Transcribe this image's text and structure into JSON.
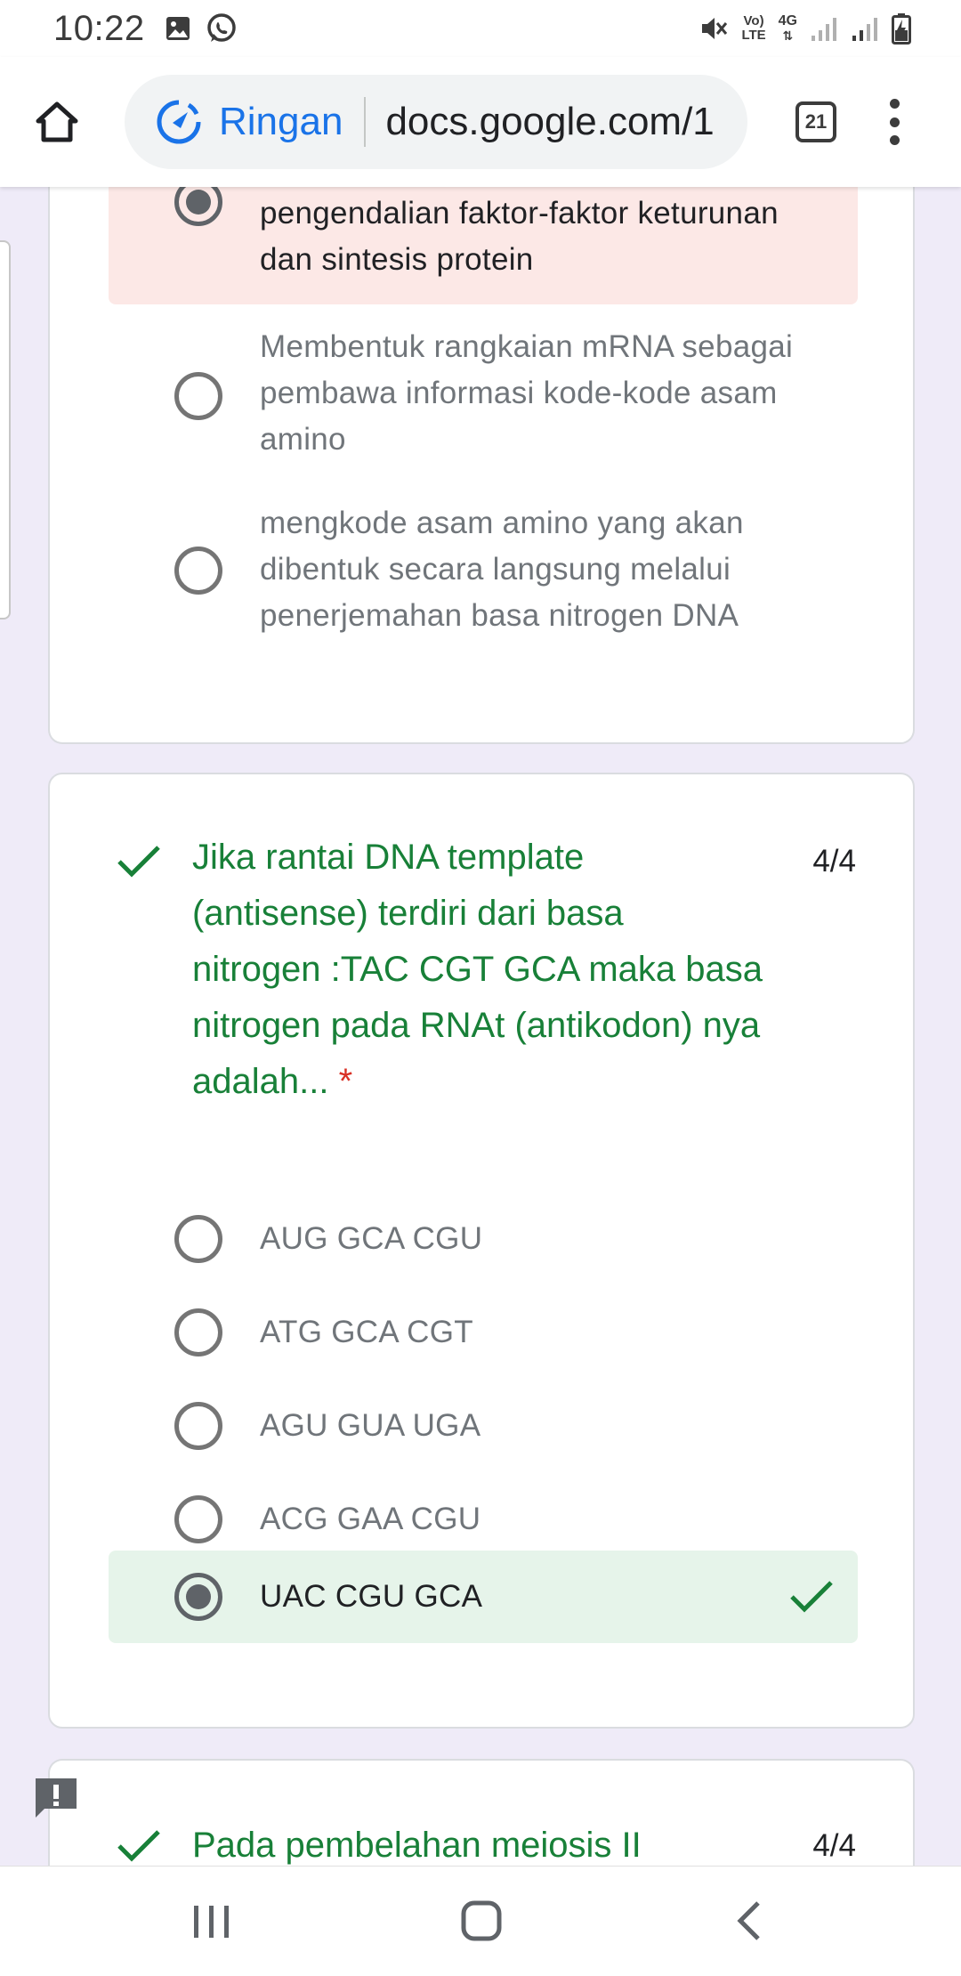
{
  "status": {
    "time": "10:22",
    "network_label_top": "Vo)",
    "network_label_bottom": "LTE",
    "network_type": "4G",
    "icons": [
      "image-icon",
      "whatsapp-icon",
      "mute-icon",
      "volte-icon",
      "4g-icon",
      "signal-icon",
      "signal-icon",
      "battery-charging-icon"
    ]
  },
  "browser": {
    "lite_mode_label": "Ringan",
    "url": "docs.google.com/1",
    "tab_count": "21"
  },
  "question_prev": {
    "options": [
      {
        "text_line1": "pengendalian faktor-faktor keturunan",
        "text_line2": "dan sintesis protein",
        "selected": true,
        "status": "wrong"
      },
      {
        "text_line1": "Membentuk rangkaian mRNA sebagai",
        "text_line2": "pembawa informasi kode-kode asam",
        "text_line3": "amino",
        "selected": false
      },
      {
        "text_line1": "mengkode asam amino yang akan",
        "text_line2": "dibentuk secara langsung melalui",
        "text_line3": "penerjemahan basa nitrogen DNA",
        "selected": false
      }
    ]
  },
  "question_dna": {
    "title_line1": "Jika rantai DNA template",
    "title_line2": "(antisense) terdiri dari basa",
    "title_line3": "nitrogen :TAC CGT GCA maka basa",
    "title_line4": "nitrogen pada RNAt (antikodon) nya",
    "title_line5": "adalah...",
    "required_mark": "*",
    "score": "4/4",
    "options": [
      {
        "text": "AUG GCA CGU",
        "selected": false
      },
      {
        "text": "ATG GCA CGT",
        "selected": false
      },
      {
        "text": "AGU GUA UGA",
        "selected": false
      },
      {
        "text": "ACG GAA CGU",
        "selected": false
      },
      {
        "text": "UAC CGU GCA",
        "selected": true,
        "status": "correct"
      }
    ]
  },
  "question_next": {
    "title": "Pada pembelahan meiosis II",
    "score": "4/4"
  },
  "colors": {
    "correct_green": "#188038",
    "wrong_red": "#d93025",
    "page_bg": "#efebf8",
    "accent_blue": "#1a73e8"
  }
}
